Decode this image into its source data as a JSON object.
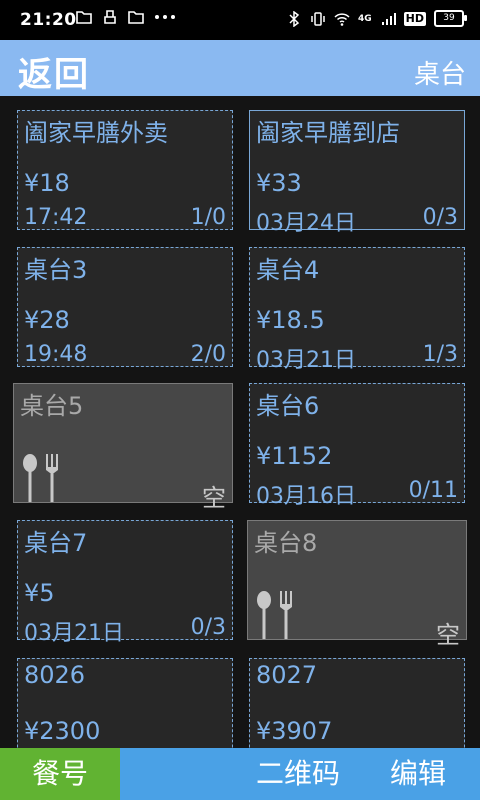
{
  "status_bar": {
    "time": "21:20",
    "network": "4G",
    "hd": "HD",
    "battery": "39"
  },
  "header": {
    "back_label": "返回",
    "title": "桌台"
  },
  "tables": [
    {
      "name": "阖家早膳外卖",
      "price": "¥18",
      "time": "17:42",
      "count": "1/0",
      "state": "occupied"
    },
    {
      "name": "阖家早膳到店",
      "price": "¥33",
      "time": "03月24日",
      "count": "0/3",
      "state": "occupied"
    },
    {
      "name": "桌台3",
      "price": "¥28",
      "time": "19:48",
      "count": "2/0",
      "state": "occupied"
    },
    {
      "name": "桌台4",
      "price": "¥18.5",
      "time": "03月21日",
      "count": "1/3",
      "state": "occupied"
    },
    {
      "name": "桌台5",
      "empty_label": "空",
      "state": "empty"
    },
    {
      "name": "桌台6",
      "price": "¥1152",
      "time": "03月16日",
      "count": "0/11",
      "state": "occupied"
    },
    {
      "name": "桌台7",
      "price": "¥5",
      "time": "03月21日",
      "count": "0/3",
      "state": "occupied"
    },
    {
      "name": "桌台8",
      "empty_label": "空",
      "state": "empty"
    },
    {
      "name": "8026",
      "price": "¥2300",
      "state": "occupied"
    },
    {
      "name": "8027",
      "price": "¥3907",
      "state": "occupied"
    }
  ],
  "bottom_bar": {
    "meal_number_label": "餐号",
    "qr_code_label": "二维码",
    "edit_label": "编辑"
  },
  "colors": {
    "header_bg": "#8ab9f1",
    "accent_text": "#7fb2ea",
    "meal_button": "#61b332",
    "bottom_bar": "#4aa1e6"
  }
}
